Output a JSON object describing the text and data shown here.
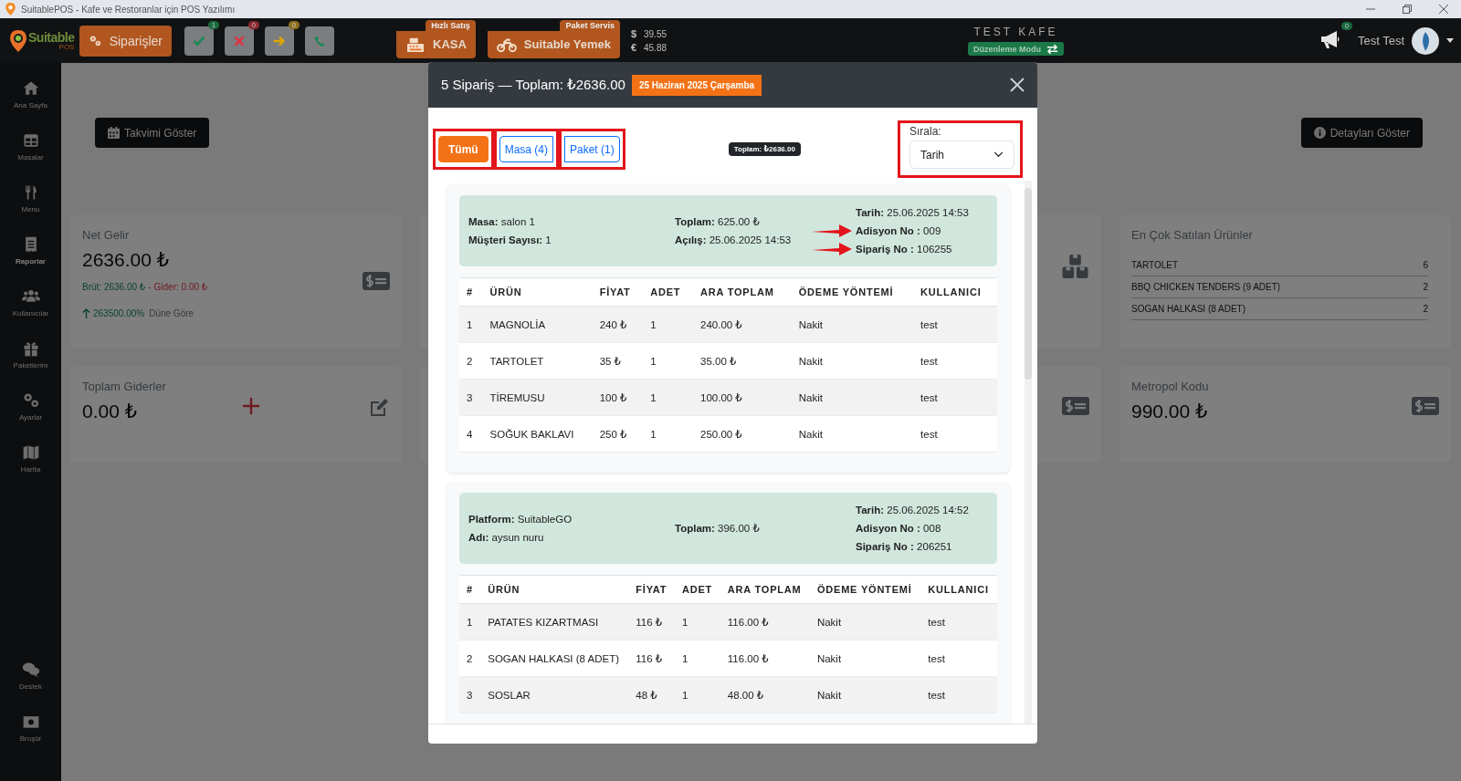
{
  "window": {
    "title": "SuitablePOS - Kafe ve Restoranlar için POS Yazılımı"
  },
  "topbar": {
    "logo": {
      "name": "Suitable",
      "sub": "POS"
    },
    "orders_button": "Siparişler",
    "status_buttons": [
      {
        "kind": "accept",
        "count": "1",
        "color": "#1a6a3c"
      },
      {
        "kind": "reject",
        "count": "0",
        "color": "#8c2a30"
      },
      {
        "kind": "forward",
        "count": "0",
        "color": "#8c7020"
      },
      {
        "kind": "call"
      }
    ],
    "quick_sale": {
      "label": "KASA",
      "tag": "Hızlı Satış"
    },
    "delivery": {
      "label": "Suitable Yemek",
      "tag": "Paket Servis"
    },
    "rates": [
      {
        "symbol": "$",
        "value": "39.55"
      },
      {
        "symbol": "€",
        "value": "45.88"
      }
    ],
    "cafe_name": "TEST KAFE",
    "mode_badge": "Düzenleme Modu",
    "notifications": "0",
    "user": "Test Test"
  },
  "sidebar": {
    "items": [
      {
        "kind": "home",
        "label": "Ana Sayfa",
        "selected": false
      },
      {
        "kind": "tables",
        "label": "Masalar",
        "selected": false
      },
      {
        "kind": "menu",
        "label": "Menu",
        "selected": false
      },
      {
        "kind": "reports",
        "label": "Raporlar",
        "selected": true
      },
      {
        "kind": "users",
        "label": "Kullanıcılar",
        "selected": false
      },
      {
        "kind": "packages",
        "label": "Paketlerim",
        "selected": false
      },
      {
        "kind": "settings",
        "label": "Ayarlar",
        "selected": false
      },
      {
        "kind": "map",
        "label": "Harita",
        "selected": false
      }
    ],
    "bottom_items": [
      {
        "kind": "support",
        "label": "Destek",
        "selected": false
      },
      {
        "kind": "brochure",
        "label": "Broşür",
        "selected": false
      }
    ]
  },
  "page": {
    "calendar_button": "Takvimi Göster",
    "details_button": "Detayları Göster",
    "cards": [
      {
        "kind": "income",
        "title": "Net Gelir",
        "value": "2636.00 ₺",
        "gross": "Brüt: 2636.00 ₺",
        "separator": "-",
        "expense": "Gider: 0.00 ₺",
        "change": "263500.00%",
        "change_label": "Düne Göre"
      },
      {
        "kind": "stock"
      },
      {
        "kind": "top_products",
        "title": "En Çok Satılan Ürünler",
        "items": [
          {
            "name": "TARTOLET",
            "count": "6"
          },
          {
            "name": "BBQ CHICKEN TENDERS (9 ADET)",
            "count": "2"
          },
          {
            "name": "SOGAN HALKASI (8 ADET)",
            "count": "2"
          }
        ]
      },
      {
        "kind": "expenses",
        "title": "Toplam Giderler",
        "value": "0.00 ₺"
      },
      {
        "kind": "amount"
      },
      {
        "kind": "amount",
        "title": "Metropol Kodu",
        "value": "990.00 ₺"
      }
    ]
  },
  "modal": {
    "title": "5 Sipariş — Toplam: ₺2636.00",
    "date_badge": "25 Haziran 2025 Çarşamba",
    "tabs": [
      {
        "label": "Tümü",
        "selected": true,
        "highlighted": true
      },
      {
        "label": "Masa (4)",
        "selected": false,
        "highlighted": true
      },
      {
        "label": "Paket (1)",
        "selected": false,
        "highlighted": true
      }
    ],
    "total_badge": "Toplam: ₺2636.00",
    "sort": {
      "label": "Sırala:",
      "value": "Tarih",
      "highlighted": true
    },
    "orders": [
      {
        "info": [
          [
            {
              "text": "**Masa:** salon 1"
            },
            {
              "text": "**Müşteri Sayısı:** 1"
            }
          ],
          [
            {
              "text": "**Toplam:** 625.00 ₺"
            },
            {
              "text": "**Açılış:** 25.06.2025 14:53"
            }
          ],
          [
            {
              "text": "**Tarih:** 25.06.2025 14:53"
            },
            {
              "text": "**Adisyon No :** 009",
              "pointer": true
            },
            {
              "text": "**Sipariş No :** 106255",
              "pointer": true
            }
          ]
        ],
        "columns": [
          "#",
          "ÜRÜN",
          "FİYAT",
          "ADET",
          "ARA TOPLAM",
          "ÖDEME YÖNTEMİ",
          "KULLANICI"
        ],
        "rows": [
          [
            "1",
            "MAGNOLİA",
            "240 ₺",
            "1",
            "240.00 ₺",
            "Nakit",
            "test"
          ],
          [
            "2",
            "TARTOLET",
            "35 ₺",
            "1",
            "35.00 ₺",
            "Nakit",
            "test"
          ],
          [
            "3",
            "TİREMUSU",
            "100 ₺",
            "1",
            "100.00 ₺",
            "Nakit",
            "test"
          ],
          [
            "4",
            "SOĞUK BAKLAVI",
            "250 ₺",
            "1",
            "250.00 ₺",
            "Nakit",
            "test"
          ]
        ]
      },
      {
        "info": [
          [
            {
              "text": "**Platform:** SuitableGO"
            },
            {
              "text": "**Adı:** aysun nuru"
            }
          ],
          [
            {
              "text": "**Toplam:** 396.00 ₺"
            }
          ],
          [
            {
              "text": "**Tarih:** 25.06.2025 14:52"
            },
            {
              "text": "**Adisyon No :** 008"
            },
            {
              "text": "**Sipariş No :** 206251"
            }
          ]
        ],
        "columns": [
          "#",
          "ÜRÜN",
          "FİYAT",
          "ADET",
          "ARA TOPLAM",
          "ÖDEME YÖNTEMİ",
          "KULLANICI"
        ],
        "rows": [
          [
            "1",
            "PATATES KIZARTMASI",
            "116 ₺",
            "1",
            "116.00 ₺",
            "Nakit",
            "test"
          ],
          [
            "2",
            "SOGAN HALKASI (8 ADET)",
            "116 ₺",
            "1",
            "116.00 ₺",
            "Nakit",
            "test"
          ],
          [
            "3",
            "SOSLAR",
            "48 ₺",
            "1",
            "48.00 ₺",
            "Nakit",
            "test"
          ]
        ]
      }
    ]
  }
}
